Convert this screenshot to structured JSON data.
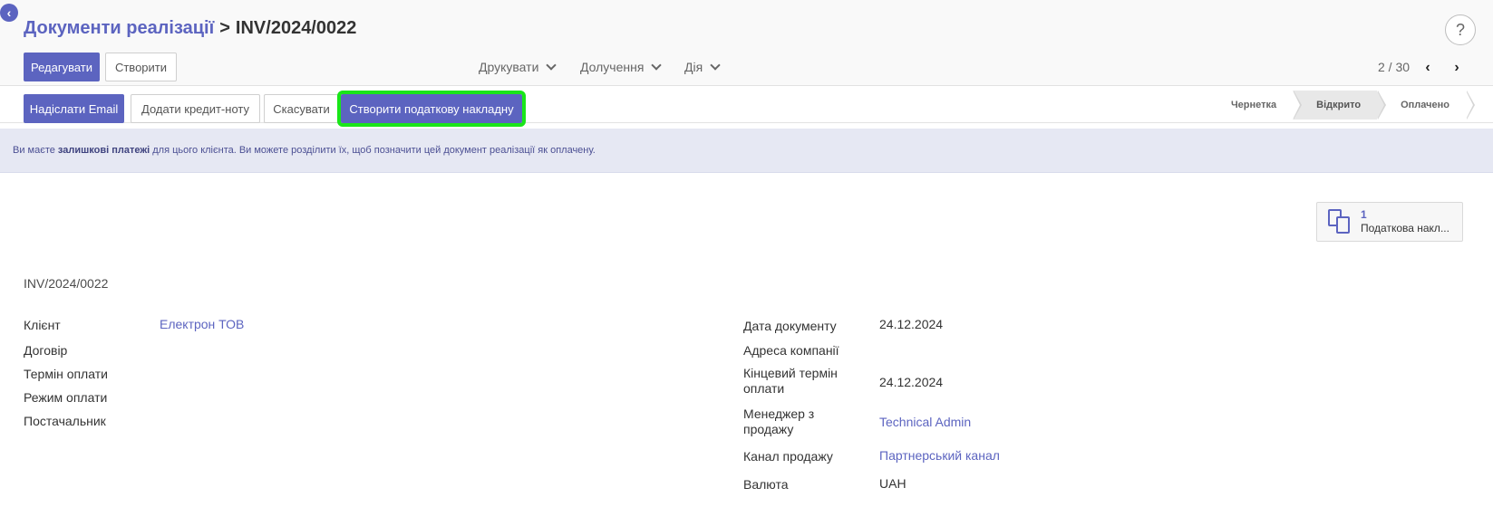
{
  "breadcrumb": {
    "parent": "Документи реалізації",
    "separator": ">",
    "current": "INV/2024/0022"
  },
  "help_icon": "?",
  "back_icon": "‹",
  "toolbar": {
    "edit_label": "Редагувати",
    "create_label": "Створити"
  },
  "menus": {
    "print": "Друкувати",
    "attachments": "Долучення",
    "action": "Дія"
  },
  "pager": {
    "value": "2 / 30"
  },
  "statusbar_buttons": {
    "send_email": "Надіслати Email",
    "add_credit_note": "Додати кредит-ноту",
    "cancel": "Скасувати",
    "create_tax_invoice": "Створити податкову накладну"
  },
  "status_steps": [
    {
      "label": "Чернетка",
      "active": false
    },
    {
      "label": "Відкрито",
      "active": true
    },
    {
      "label": "Оплачено",
      "active": false
    }
  ],
  "alert": {
    "prefix": "Ви маєте ",
    "bold": "залишкові платежі",
    "suffix": " для цього клієнта. Ви можете розділити їх, щоб позначити цей документ реалізації як оплачену."
  },
  "smart_button": {
    "count": "1",
    "label": "Податкова накл..."
  },
  "record_name": "INV/2024/0022",
  "left_fields": {
    "client_label": "Клієнт",
    "client_value": "Електрон ТОВ",
    "contract_label": "Договір",
    "payment_term_label": "Термін оплати",
    "payment_mode_label": "Режим оплати",
    "supplier_label": "Постачальник"
  },
  "right_fields": {
    "doc_date_label": "Дата документу",
    "doc_date_value": "24.12.2024",
    "company_address_label": "Адреса компанії",
    "due_date_label_1": "Кінцевий термін",
    "due_date_label_2": "оплати",
    "due_date_value": "24.12.2024",
    "sales_manager_label_1": "Менеджер з",
    "sales_manager_label_2": "продажу",
    "sales_manager_value": "Technical Admin",
    "sales_channel_label": "Канал продажу",
    "sales_channel_value": "Партнерський канал",
    "currency_label": "Валюта",
    "currency_value": "UAH"
  },
  "colors": {
    "accent": "#5c64c0",
    "highlight": "#19e619",
    "alert_bg": "#e6e8f3"
  }
}
